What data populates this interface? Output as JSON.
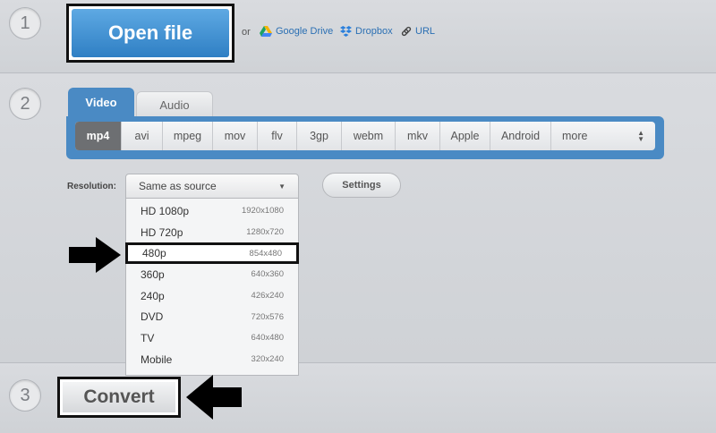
{
  "steps": [
    {
      "number": "1"
    },
    {
      "number": "2"
    },
    {
      "number": "3"
    }
  ],
  "open": {
    "button_label": "Open file",
    "or_text": "or",
    "sources": [
      {
        "label": "Google Drive",
        "icon": "google-drive-icon"
      },
      {
        "label": "Dropbox",
        "icon": "dropbox-icon"
      },
      {
        "label": "URL",
        "icon": "link-icon"
      }
    ]
  },
  "tabs": [
    {
      "label": "Video",
      "active": true
    },
    {
      "label": "Audio",
      "active": false
    }
  ],
  "formats": [
    {
      "label": "mp4",
      "selected": true
    },
    {
      "label": "avi"
    },
    {
      "label": "mpeg"
    },
    {
      "label": "mov"
    },
    {
      "label": "flv"
    },
    {
      "label": "3gp"
    },
    {
      "label": "webm"
    },
    {
      "label": "mkv"
    },
    {
      "label": "Apple"
    },
    {
      "label": "Android"
    },
    {
      "label": "more"
    }
  ],
  "resolution": {
    "label": "Resolution:",
    "selected": "Same as source",
    "settings_label": "Settings",
    "options": [
      {
        "name": "HD 1080p",
        "size": "1920x1080"
      },
      {
        "name": "HD 720p",
        "size": "1280x720"
      },
      {
        "name": "480p",
        "size": "854x480",
        "highlighted": true
      },
      {
        "name": "360p",
        "size": "640x360"
      },
      {
        "name": "240p",
        "size": "426x240"
      },
      {
        "name": "DVD",
        "size": "720x576"
      },
      {
        "name": "TV",
        "size": "640x480"
      },
      {
        "name": "Mobile",
        "size": "320x240"
      }
    ]
  },
  "convert": {
    "button_label": "Convert"
  },
  "colors": {
    "accent": "#4a8ac4",
    "button_blue": "#2f7fc4",
    "link": "#2b6fb3"
  }
}
